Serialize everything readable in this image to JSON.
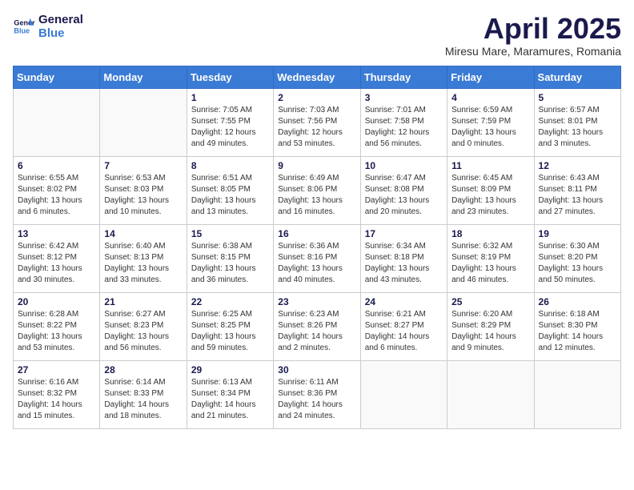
{
  "logo": {
    "line1": "General",
    "line2": "Blue"
  },
  "title": "April 2025",
  "subtitle": "Miresu Mare, Maramures, Romania",
  "weekdays": [
    "Sunday",
    "Monday",
    "Tuesday",
    "Wednesday",
    "Thursday",
    "Friday",
    "Saturday"
  ],
  "weeks": [
    [
      {
        "day": "",
        "info": ""
      },
      {
        "day": "",
        "info": ""
      },
      {
        "day": "1",
        "info": "Sunrise: 7:05 AM\nSunset: 7:55 PM\nDaylight: 12 hours and 49 minutes."
      },
      {
        "day": "2",
        "info": "Sunrise: 7:03 AM\nSunset: 7:56 PM\nDaylight: 12 hours and 53 minutes."
      },
      {
        "day": "3",
        "info": "Sunrise: 7:01 AM\nSunset: 7:58 PM\nDaylight: 12 hours and 56 minutes."
      },
      {
        "day": "4",
        "info": "Sunrise: 6:59 AM\nSunset: 7:59 PM\nDaylight: 13 hours and 0 minutes."
      },
      {
        "day": "5",
        "info": "Sunrise: 6:57 AM\nSunset: 8:01 PM\nDaylight: 13 hours and 3 minutes."
      }
    ],
    [
      {
        "day": "6",
        "info": "Sunrise: 6:55 AM\nSunset: 8:02 PM\nDaylight: 13 hours and 6 minutes."
      },
      {
        "day": "7",
        "info": "Sunrise: 6:53 AM\nSunset: 8:03 PM\nDaylight: 13 hours and 10 minutes."
      },
      {
        "day": "8",
        "info": "Sunrise: 6:51 AM\nSunset: 8:05 PM\nDaylight: 13 hours and 13 minutes."
      },
      {
        "day": "9",
        "info": "Sunrise: 6:49 AM\nSunset: 8:06 PM\nDaylight: 13 hours and 16 minutes."
      },
      {
        "day": "10",
        "info": "Sunrise: 6:47 AM\nSunset: 8:08 PM\nDaylight: 13 hours and 20 minutes."
      },
      {
        "day": "11",
        "info": "Sunrise: 6:45 AM\nSunset: 8:09 PM\nDaylight: 13 hours and 23 minutes."
      },
      {
        "day": "12",
        "info": "Sunrise: 6:43 AM\nSunset: 8:11 PM\nDaylight: 13 hours and 27 minutes."
      }
    ],
    [
      {
        "day": "13",
        "info": "Sunrise: 6:42 AM\nSunset: 8:12 PM\nDaylight: 13 hours and 30 minutes."
      },
      {
        "day": "14",
        "info": "Sunrise: 6:40 AM\nSunset: 8:13 PM\nDaylight: 13 hours and 33 minutes."
      },
      {
        "day": "15",
        "info": "Sunrise: 6:38 AM\nSunset: 8:15 PM\nDaylight: 13 hours and 36 minutes."
      },
      {
        "day": "16",
        "info": "Sunrise: 6:36 AM\nSunset: 8:16 PM\nDaylight: 13 hours and 40 minutes."
      },
      {
        "day": "17",
        "info": "Sunrise: 6:34 AM\nSunset: 8:18 PM\nDaylight: 13 hours and 43 minutes."
      },
      {
        "day": "18",
        "info": "Sunrise: 6:32 AM\nSunset: 8:19 PM\nDaylight: 13 hours and 46 minutes."
      },
      {
        "day": "19",
        "info": "Sunrise: 6:30 AM\nSunset: 8:20 PM\nDaylight: 13 hours and 50 minutes."
      }
    ],
    [
      {
        "day": "20",
        "info": "Sunrise: 6:28 AM\nSunset: 8:22 PM\nDaylight: 13 hours and 53 minutes."
      },
      {
        "day": "21",
        "info": "Sunrise: 6:27 AM\nSunset: 8:23 PM\nDaylight: 13 hours and 56 minutes."
      },
      {
        "day": "22",
        "info": "Sunrise: 6:25 AM\nSunset: 8:25 PM\nDaylight: 13 hours and 59 minutes."
      },
      {
        "day": "23",
        "info": "Sunrise: 6:23 AM\nSunset: 8:26 PM\nDaylight: 14 hours and 2 minutes."
      },
      {
        "day": "24",
        "info": "Sunrise: 6:21 AM\nSunset: 8:27 PM\nDaylight: 14 hours and 6 minutes."
      },
      {
        "day": "25",
        "info": "Sunrise: 6:20 AM\nSunset: 8:29 PM\nDaylight: 14 hours and 9 minutes."
      },
      {
        "day": "26",
        "info": "Sunrise: 6:18 AM\nSunset: 8:30 PM\nDaylight: 14 hours and 12 minutes."
      }
    ],
    [
      {
        "day": "27",
        "info": "Sunrise: 6:16 AM\nSunset: 8:32 PM\nDaylight: 14 hours and 15 minutes."
      },
      {
        "day": "28",
        "info": "Sunrise: 6:14 AM\nSunset: 8:33 PM\nDaylight: 14 hours and 18 minutes."
      },
      {
        "day": "29",
        "info": "Sunrise: 6:13 AM\nSunset: 8:34 PM\nDaylight: 14 hours and 21 minutes."
      },
      {
        "day": "30",
        "info": "Sunrise: 6:11 AM\nSunset: 8:36 PM\nDaylight: 14 hours and 24 minutes."
      },
      {
        "day": "",
        "info": ""
      },
      {
        "day": "",
        "info": ""
      },
      {
        "day": "",
        "info": ""
      }
    ]
  ]
}
